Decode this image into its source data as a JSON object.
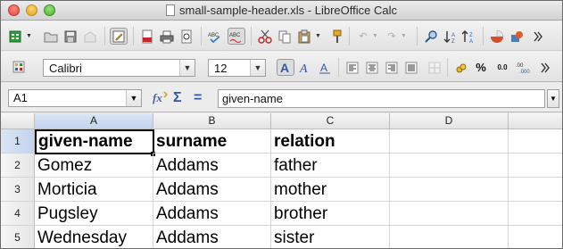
{
  "window": {
    "title": "small-sample-header.xls - LibreOffice Calc"
  },
  "toolbar2": {
    "font_name": "Calibri",
    "font_size": "12",
    "percent_label": "%",
    "decimal_label": "0.0"
  },
  "formula_bar": {
    "cell_ref": "A1",
    "sum_symbol": "Σ",
    "equals_symbol": "=",
    "content": "given-name"
  },
  "grid": {
    "columns": [
      "A",
      "B",
      "C",
      "D"
    ],
    "rows": [
      "1",
      "2",
      "3",
      "4",
      "5"
    ],
    "cells": [
      [
        "given-name",
        "surname",
        "relation",
        ""
      ],
      [
        "Gomez",
        "Addams",
        "father",
        ""
      ],
      [
        "Morticia",
        "Addams",
        "mother",
        ""
      ],
      [
        "Pugsley",
        "Addams",
        "brother",
        ""
      ],
      [
        "Wednesday",
        "Addams",
        "sister",
        ""
      ]
    ]
  }
}
